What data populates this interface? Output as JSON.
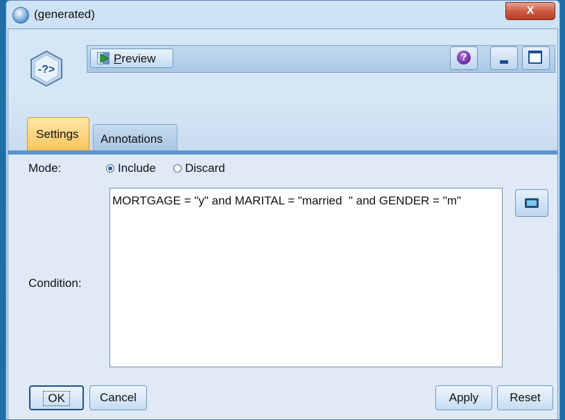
{
  "window": {
    "title": "(generated)",
    "close_label": "X"
  },
  "toolbar": {
    "preview_label": "Preview",
    "help_label": "?"
  },
  "tabs": [
    {
      "label": "Settings",
      "active": true
    },
    {
      "label": "Annotations",
      "active": false
    }
  ],
  "settings": {
    "mode_label": "Mode:",
    "mode_options": [
      {
        "label": "Include",
        "selected": true
      },
      {
        "label": "Discard",
        "selected": false
      }
    ],
    "condition_label": "Condition:",
    "condition_value": "MORTGAGE = \"y\" and MARITAL = \"married  \" and GENDER = \"m\""
  },
  "buttons": {
    "ok": "OK",
    "cancel": "Cancel",
    "apply": "Apply",
    "reset": "Reset"
  },
  "icons": {
    "node": "select-node-icon",
    "preview": "play-preview-icon",
    "help": "help-icon",
    "minimize": "minimize-icon",
    "maximize": "maximize-icon",
    "expression_builder": "calculator-icon"
  },
  "colors": {
    "active_tab": "#f8c459",
    "tab_line": "#5e95c9",
    "help": "#6b2aa0"
  }
}
